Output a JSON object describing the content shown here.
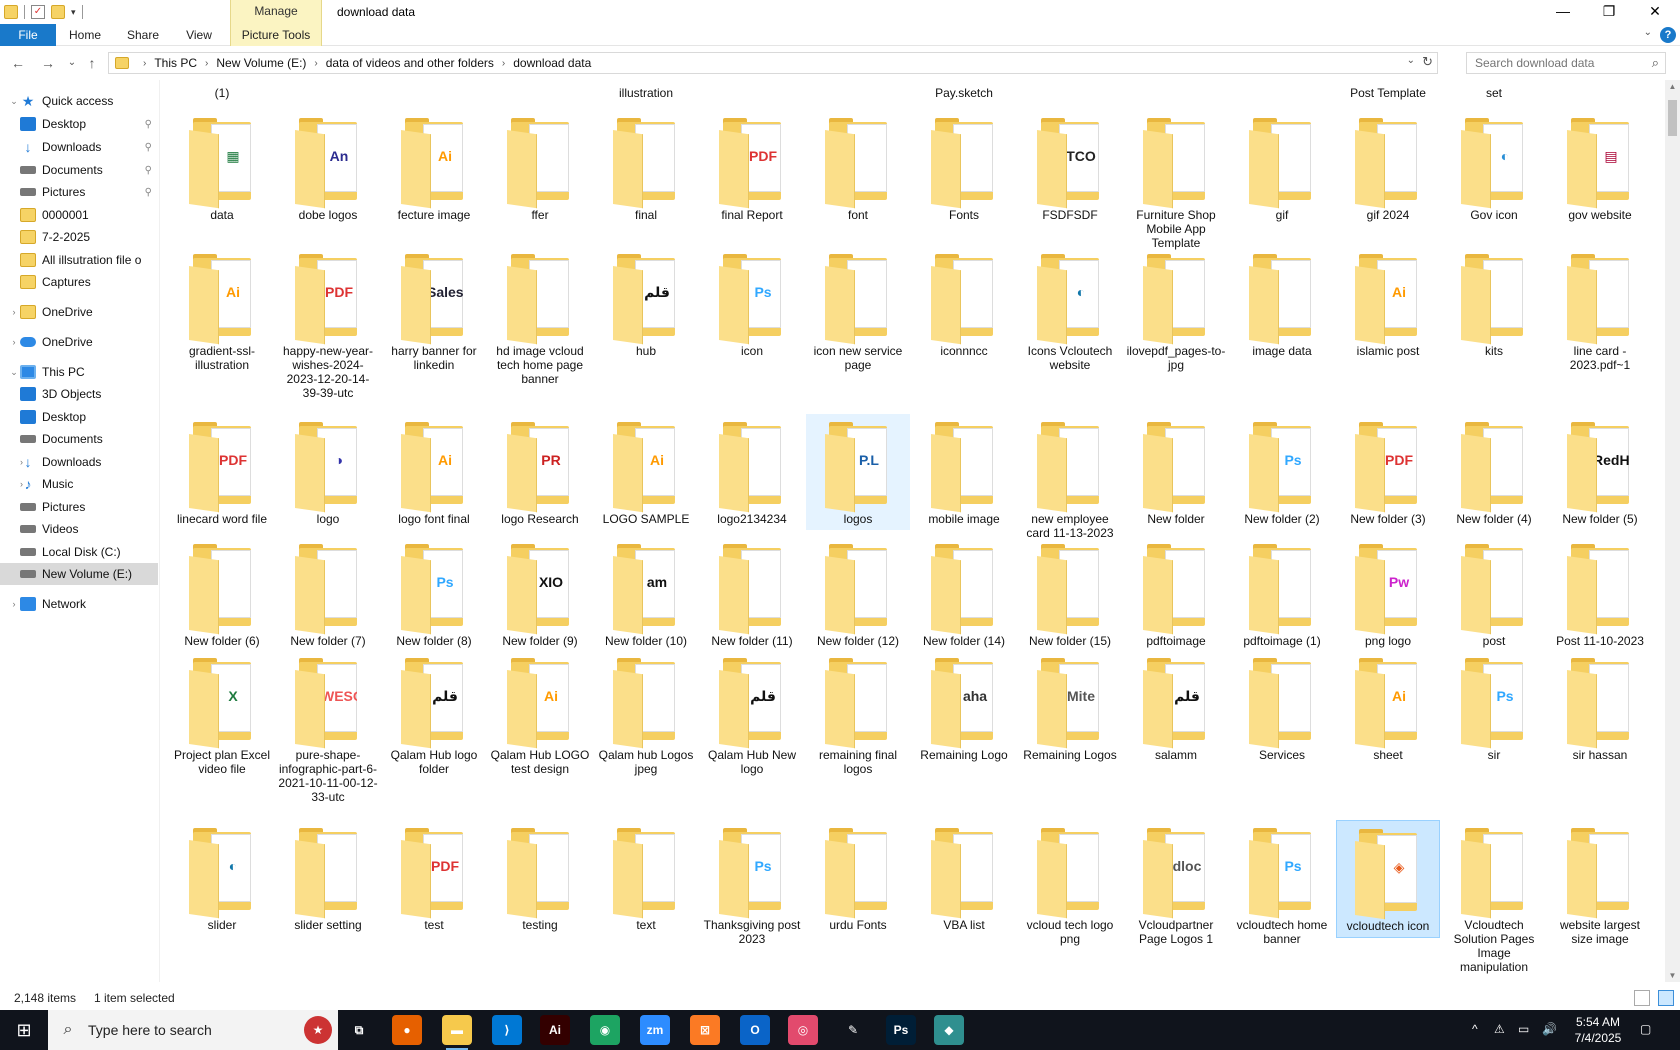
{
  "window": {
    "title": "download data",
    "manage_tab": "Manage",
    "minimize": "—",
    "maximize": "❐",
    "close": "✕"
  },
  "ribbon": {
    "tabs": [
      "File",
      "Home",
      "Share",
      "View",
      "Picture Tools"
    ],
    "chevron": "⌄",
    "help": "?"
  },
  "nav": {
    "back": "←",
    "forward": "→",
    "recent": "⌄",
    "up": "↑",
    "breadcrumb": [
      "This PC",
      "New Volume (E:)",
      "data of videos and other folders",
      "download data"
    ],
    "dropdown": "⌄",
    "refresh": "↻",
    "search_placeholder": "Search download data",
    "search_icon": "⌕"
  },
  "sidebar": {
    "items": [
      {
        "label": "Quick access",
        "icon": "star-icon",
        "expand": "⌄",
        "pinned": false
      },
      {
        "label": "Desktop",
        "icon": "desktop-icon",
        "pinned": true
      },
      {
        "label": "Downloads",
        "icon": "download-icon",
        "pinned": true
      },
      {
        "label": "Documents",
        "icon": "documents-icon",
        "pinned": true
      },
      {
        "label": "Pictures",
        "icon": "pictures-icon",
        "pinned": true
      },
      {
        "label": "0000001",
        "icon": "folder-icon",
        "pinned": false
      },
      {
        "label": "7-2-2025",
        "icon": "folder-icon",
        "pinned": false
      },
      {
        "label": "All illsutration file o",
        "icon": "folder-icon",
        "pinned": false
      },
      {
        "label": "Captures",
        "icon": "folder-icon",
        "pinned": false
      },
      {
        "label": "OneDrive",
        "icon": "onedrive-folder-icon",
        "expand": "›"
      },
      {
        "label": "OneDrive",
        "icon": "onedrive-cloud-icon",
        "expand": "›"
      },
      {
        "label": "This PC",
        "icon": "this-pc-icon",
        "expand": "⌄"
      },
      {
        "label": "3D Objects",
        "icon": "3d-objects-icon",
        "expand": "›"
      },
      {
        "label": "Desktop",
        "icon": "desktop-icon",
        "expand": "›"
      },
      {
        "label": "Documents",
        "icon": "documents-icon",
        "expand": "›"
      },
      {
        "label": "Downloads",
        "icon": "download-icon",
        "expand": "›"
      },
      {
        "label": "Music",
        "icon": "music-icon",
        "expand": "›"
      },
      {
        "label": "Pictures",
        "icon": "pictures-icon",
        "expand": "›"
      },
      {
        "label": "Videos",
        "icon": "videos-icon",
        "expand": "›"
      },
      {
        "label": "Local Disk (C:)",
        "icon": "local-disk-icon",
        "expand": "›"
      },
      {
        "label": "New Volume (E:)",
        "icon": "drive-icon",
        "expand": "›",
        "selected": true
      },
      {
        "label": "Network",
        "icon": "network-icon",
        "expand": "›"
      }
    ],
    "pin_glyph": "📌"
  },
  "partial_row": [
    "(1)",
    "",
    "",
    "",
    "illustration",
    "",
    "",
    "Pay.sketch",
    "",
    "",
    "",
    "Post Template",
    "set",
    ""
  ],
  "folders": [
    {
      "name": "data",
      "thumb": "▦",
      "tc": "#1d7a3e"
    },
    {
      "name": "dobe logos",
      "thumb": "An",
      "tc": "#2b2b8f"
    },
    {
      "name": "fecture image",
      "thumb": "Ai",
      "tc": "#ff9a00"
    },
    {
      "name": "ffer",
      "thumb": "",
      "tc": "#666"
    },
    {
      "name": "final",
      "thumb": "",
      "tc": "#a00"
    },
    {
      "name": "final Report",
      "thumb": "PDF",
      "tc": "#d33"
    },
    {
      "name": "font",
      "thumb": "",
      "tc": "#888"
    },
    {
      "name": "Fonts",
      "thumb": "",
      "tc": "#888"
    },
    {
      "name": "FSDFSDF",
      "thumb": "TCO",
      "tc": "#222"
    },
    {
      "name": "Furniture Shop Mobile App Template",
      "thumb": "",
      "tc": "#334"
    },
    {
      "name": "gif",
      "thumb": "",
      "tc": "#c33"
    },
    {
      "name": "gif 2024",
      "thumb": "",
      "tc": "#422"
    },
    {
      "name": "Gov icon",
      "thumb": "◐",
      "tc": "#2a8fd6"
    },
    {
      "name": "gov website",
      "thumb": "▤",
      "tc": "#a03"
    },
    {
      "name": "gradient-ssl-illustration",
      "thumb": "Ai",
      "tc": "#ff9a00"
    },
    {
      "name": "happy-new-year-wishes-2024-2023-12-20-14-39-39-utc",
      "thumb": "PDF",
      "tc": "#d33"
    },
    {
      "name": "harry banner for linkedin",
      "thumb": "Sales",
      "tc": "#223"
    },
    {
      "name": "hd image vcloud tech home page banner",
      "thumb": "",
      "tc": "#456"
    },
    {
      "name": "hub",
      "thumb": "قلم",
      "tc": "#111"
    },
    {
      "name": "icon",
      "thumb": "Ps",
      "tc": "#31a8ff"
    },
    {
      "name": "icon new service page",
      "thumb": "",
      "tc": "#556"
    },
    {
      "name": "iconnncc",
      "thumb": "",
      "tc": "#222"
    },
    {
      "name": "Icons Vcloutech website",
      "thumb": "◐",
      "tc": "#17a"
    },
    {
      "name": "ilovepdf_pages-to-jpg",
      "thumb": "",
      "tc": "#999"
    },
    {
      "name": "image data",
      "thumb": "",
      "tc": "#d33"
    },
    {
      "name": "islamic post",
      "thumb": "Ai",
      "tc": "#ff9a00"
    },
    {
      "name": "kits",
      "thumb": "",
      "tc": "#888"
    },
    {
      "name": "line card - 2023.pdf~1",
      "thumb": "",
      "tc": "#999"
    },
    {
      "name": "linecard word file",
      "thumb": "PDF",
      "tc": "#d33"
    },
    {
      "name": "logo",
      "thumb": "◑",
      "tc": "#33a"
    },
    {
      "name": "logo font final",
      "thumb": "Ai",
      "tc": "#ff9a00"
    },
    {
      "name": "logo Research",
      "thumb": "PR",
      "tc": "#c22"
    },
    {
      "name": "LOGO SAMPLE",
      "thumb": "Ai",
      "tc": "#ff9a00"
    },
    {
      "name": "logo2134234",
      "thumb": "",
      "tc": "#888"
    },
    {
      "name": "logos",
      "thumb": "P.L",
      "tc": "#1a5fa8",
      "hovered": true
    },
    {
      "name": "mobile image",
      "thumb": "",
      "tc": "#334"
    },
    {
      "name": "new employee card 11-13-2023",
      "thumb": "",
      "tc": "#888"
    },
    {
      "name": "New folder",
      "thumb": "",
      "tc": "#223"
    },
    {
      "name": "New folder (2)",
      "thumb": "Ps",
      "tc": "#31a8ff"
    },
    {
      "name": "New folder (3)",
      "thumb": "PDF",
      "tc": "#d33"
    },
    {
      "name": "New folder (4)",
      "thumb": "",
      "tc": "#444"
    },
    {
      "name": "New folder (5)",
      "thumb": "RedH",
      "tc": "#111"
    },
    {
      "name": "New folder (6)",
      "thumb": "",
      "tc": "#345"
    },
    {
      "name": "New folder (7)",
      "thumb": "",
      "tc": "#543"
    },
    {
      "name": "New folder (8)",
      "thumb": "Ps",
      "tc": "#31a8ff"
    },
    {
      "name": "New folder (9)",
      "thumb": "XIO",
      "tc": "#111"
    },
    {
      "name": "New folder (10)",
      "thumb": "am",
      "tc": "#111"
    },
    {
      "name": "New folder (11)",
      "thumb": "",
      "tc": "#222"
    },
    {
      "name": "New folder (12)",
      "thumb": "",
      "tc": "#c33"
    },
    {
      "name": "New folder (14)",
      "thumb": "",
      "tc": "#cb5"
    },
    {
      "name": "New folder (15)",
      "thumb": "",
      "tc": "#444"
    },
    {
      "name": "pdftoimage",
      "thumb": "",
      "tc": "#888"
    },
    {
      "name": "pdftoimage (1)",
      "thumb": "",
      "tc": "#888"
    },
    {
      "name": "png logo",
      "thumb": "Pw",
      "tc": "#c2c"
    },
    {
      "name": "post",
      "thumb": "",
      "tc": "#888"
    },
    {
      "name": "Post 11-10-2023",
      "thumb": "",
      "tc": "#c33"
    },
    {
      "name": "Project plan Excel video file",
      "thumb": "X",
      "tc": "#1d7a3e"
    },
    {
      "name": "pure-shape-infographic-part-6-2021-10-11-00-12-33-utc",
      "thumb": "WESO",
      "tc": "#e55"
    },
    {
      "name": "Qalam Hub logo folder",
      "thumb": "قلم",
      "tc": "#111"
    },
    {
      "name": "Qalam Hub LOGO test design",
      "thumb": "Ai",
      "tc": "#ff9a00"
    },
    {
      "name": "Qalam hub Logos jpeg",
      "thumb": "",
      "tc": "#338"
    },
    {
      "name": "Qalam Hub New logo",
      "thumb": "قلم",
      "tc": "#111"
    },
    {
      "name": "remaining final logos",
      "thumb": "",
      "tc": "#c84"
    },
    {
      "name": "Remaining Logo",
      "thumb": "aha",
      "tc": "#333"
    },
    {
      "name": "Remaining Logos",
      "thumb": "Mite",
      "tc": "#555"
    },
    {
      "name": "salamm",
      "thumb": "قلم",
      "tc": "#111"
    },
    {
      "name": "Services",
      "thumb": "",
      "tc": "#234"
    },
    {
      "name": "sheet",
      "thumb": "Ai",
      "tc": "#ff9a00"
    },
    {
      "name": "sir",
      "thumb": "Ps",
      "tc": "#31a8ff"
    },
    {
      "name": "sir hassan",
      "thumb": "",
      "tc": "#345"
    },
    {
      "name": "slider",
      "thumb": "◐",
      "tc": "#17a"
    },
    {
      "name": "slider setting",
      "thumb": "",
      "tc": "#e84"
    },
    {
      "name": "test",
      "thumb": "PDF",
      "tc": "#d33"
    },
    {
      "name": "testing",
      "thumb": "",
      "tc": "#888"
    },
    {
      "name": "text",
      "thumb": "",
      "tc": "#999"
    },
    {
      "name": "Thanksgiving post 2023",
      "thumb": "Ps",
      "tc": "#31a8ff"
    },
    {
      "name": "urdu Fonts",
      "thumb": "",
      "tc": "#888"
    },
    {
      "name": "VBA list",
      "thumb": "",
      "tc": "#1d7a3e"
    },
    {
      "name": "vcloud tech  logo png",
      "thumb": "",
      "tc": "#888"
    },
    {
      "name": "Vcloudpartner Page Logos 1",
      "thumb": "dloc",
      "tc": "#555"
    },
    {
      "name": "vcloudtech home banner",
      "thumb": "Ps",
      "tc": "#31a8ff"
    },
    {
      "name": "vcloudtech icon",
      "thumb": "◈",
      "tc": "#e85a1b",
      "selected": true
    },
    {
      "name": "Vcloudtech Solution Pages Image manipulation",
      "thumb": "",
      "tc": "#345"
    },
    {
      "name": "website largest size image",
      "thumb": "",
      "tc": "#543"
    }
  ],
  "status": {
    "count": "2,148 items",
    "selected": "1 item selected"
  },
  "taskbar": {
    "search_placeholder": "Type here to search",
    "apps": [
      {
        "name": "task-view",
        "glyph": "⧉",
        "bg": "transparent"
      },
      {
        "name": "firefox",
        "glyph": "●",
        "bg": "#e66000"
      },
      {
        "name": "file-explorer",
        "glyph": "▬",
        "bg": "#f6c94c"
      },
      {
        "name": "vscode",
        "glyph": "⟩",
        "bg": "#0078d4"
      },
      {
        "name": "illustrator",
        "glyph": "Ai",
        "bg": "#330000"
      },
      {
        "name": "chrome",
        "glyph": "◉",
        "bg": "#1da462"
      },
      {
        "name": "zoom",
        "glyph": "zm",
        "bg": "#2d8cff"
      },
      {
        "name": "xampp",
        "glyph": "⊠",
        "bg": "#fb7a24"
      },
      {
        "name": "outlook",
        "glyph": "O",
        "bg": "#0a64c8"
      },
      {
        "name": "creative-cloud",
        "glyph": "◎",
        "bg": "#e24a6d"
      },
      {
        "name": "pen-tool",
        "glyph": "✎",
        "bg": "transparent"
      },
      {
        "name": "photoshop",
        "glyph": "Ps",
        "bg": "#001e36"
      },
      {
        "name": "app-green",
        "glyph": "◆",
        "bg": "#2f8f8f"
      }
    ],
    "tray": [
      "^",
      "⚠",
      "▭",
      "🔊"
    ],
    "time": "5:54 AM",
    "date": "7/4/2025",
    "notify": "▢"
  }
}
